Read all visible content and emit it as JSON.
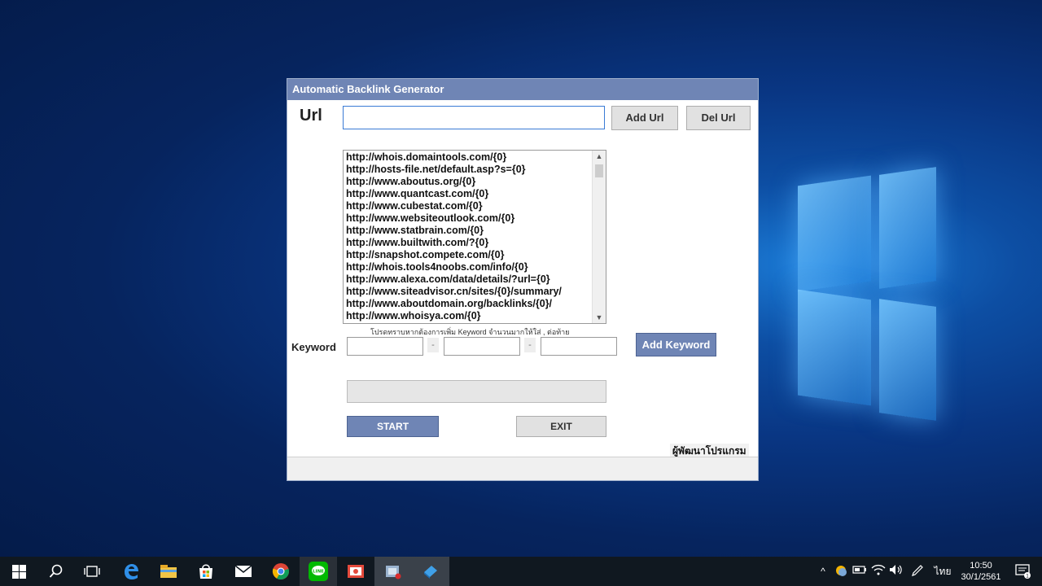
{
  "window": {
    "title": "Automatic Backlink Generator"
  },
  "url_section": {
    "label": "Url",
    "input_value": "",
    "add_button": "Add Url",
    "del_button": "Del Url"
  },
  "url_list": [
    "http://whois.domaintools.com/{0}",
    "http://hosts-file.net/default.asp?s={0}",
    "http://www.aboutus.org/{0}",
    "http://www.quantcast.com/{0}",
    "http://www.cubestat.com/{0}",
    "http://www.websiteoutlook.com/{0}",
    "http://www.statbrain.com/{0}",
    "http://www.builtwith.com/?{0}",
    "http://snapshot.compete.com/{0}",
    "http://whois.tools4noobs.com/info/{0}",
    "http://www.alexa.com/data/details/?url={0}",
    "http://www.siteadvisor.cn/sites/{0}/summary/",
    "http://www.aboutdomain.org/backlinks/{0}/",
    "http://www.whoisya.com/{0}"
  ],
  "keyword_section": {
    "hint": "โปรดทราบหากต้องการเพิ่ม Keyword จำนวนมากให้ใส่ , ต่อท้าย",
    "label": "Keyword",
    "separator": "-",
    "add_button": "Add Keyword"
  },
  "progress": {
    "value": 0
  },
  "actions": {
    "start": "START",
    "exit": "EXIT"
  },
  "developer_label": "ผู้พัฒนาโปรแกรม",
  "taskbar": {
    "time": "10:50",
    "date": "30/1/2561",
    "language": "ไทย",
    "notification_count": "1"
  }
}
